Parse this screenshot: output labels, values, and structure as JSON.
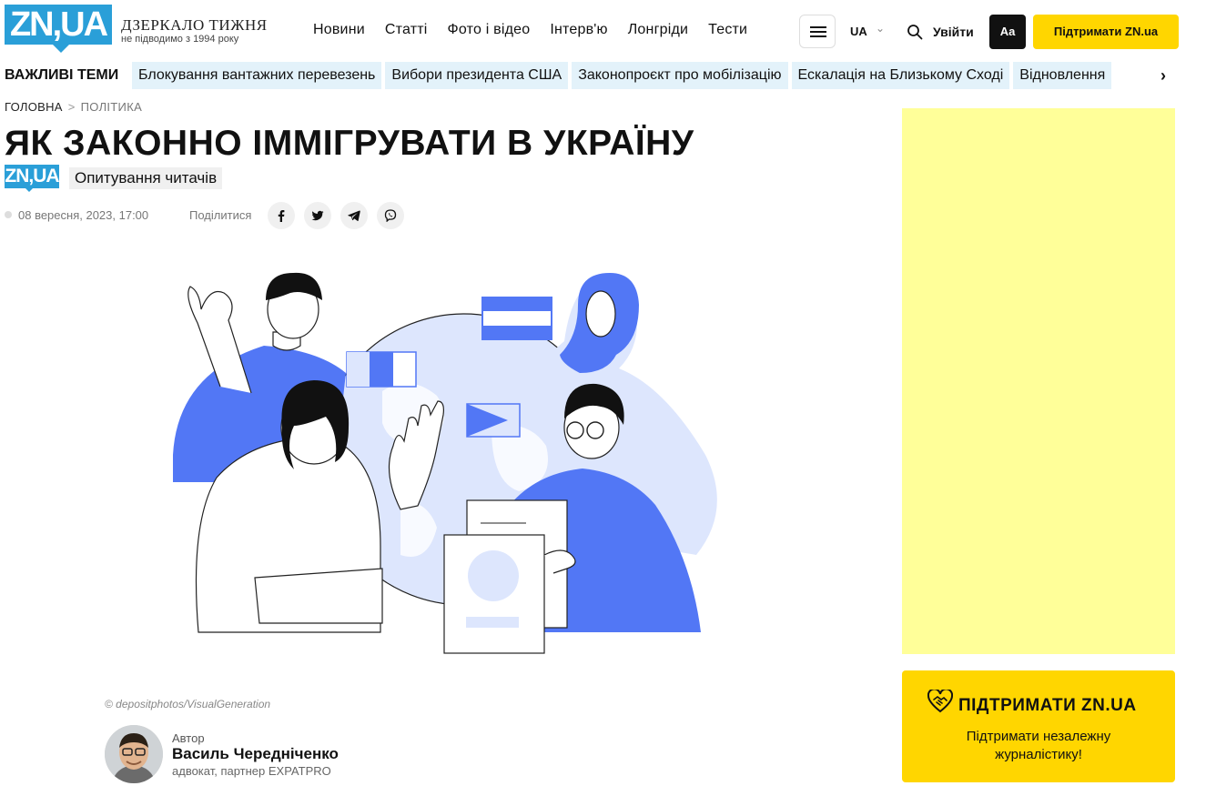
{
  "header": {
    "logo_text": "ZN,UA",
    "brand_title": "ДЗЕРКАЛО ТИЖНЯ",
    "brand_subtitle": "не підводимо з 1994 року",
    "nav": [
      "Новини",
      "Статті",
      "Фото і відео",
      "Інтерв'ю",
      "Лонгріди",
      "Тести"
    ],
    "language": "UA",
    "login_label": "Увійти",
    "font_size_label": "Aa",
    "support_label": "Підтримати ZN.ua"
  },
  "topics": {
    "label": "ВАЖЛИВІ ТЕМИ",
    "items": [
      "Блокування вантажних перевезень",
      "Вибори президента США",
      "Законопроєкт про мобілізацію",
      "Ескалація на Близькому Сході",
      "Відновлення"
    ]
  },
  "breadcrumb": {
    "home": "ГОЛОВНА",
    "category": "ПОЛІТИКА"
  },
  "article": {
    "title": "ЯК ЗАКОННО ІММІГРУВАТИ В УКРАЇНУ",
    "badge_logo": "ZN,UA",
    "rubric": "Опитування читачів",
    "date": "08 вересня, 2023, 17:00",
    "share_label": "Поділитися",
    "share_icons": [
      "facebook-icon",
      "twitter-icon",
      "telegram-icon",
      "viber-icon"
    ],
    "image_credit": "© depositphotos/VisualGeneration"
  },
  "author": {
    "label": "Автор",
    "name": "Василь Чередніченко",
    "role": "адвокат, партнер EXPATPRO"
  },
  "sidebar": {
    "support_title": "ПІДТРИМАТИ ZN.UA",
    "support_text": "Підтримати незалежну журналістику!"
  },
  "colors": {
    "brand_blue": "#2a9fd8",
    "accent_yellow": "#ffd600",
    "ad_yellow": "#ffff99",
    "illustration_blue": "#5277f5",
    "illustration_light": "#dde6fd"
  }
}
